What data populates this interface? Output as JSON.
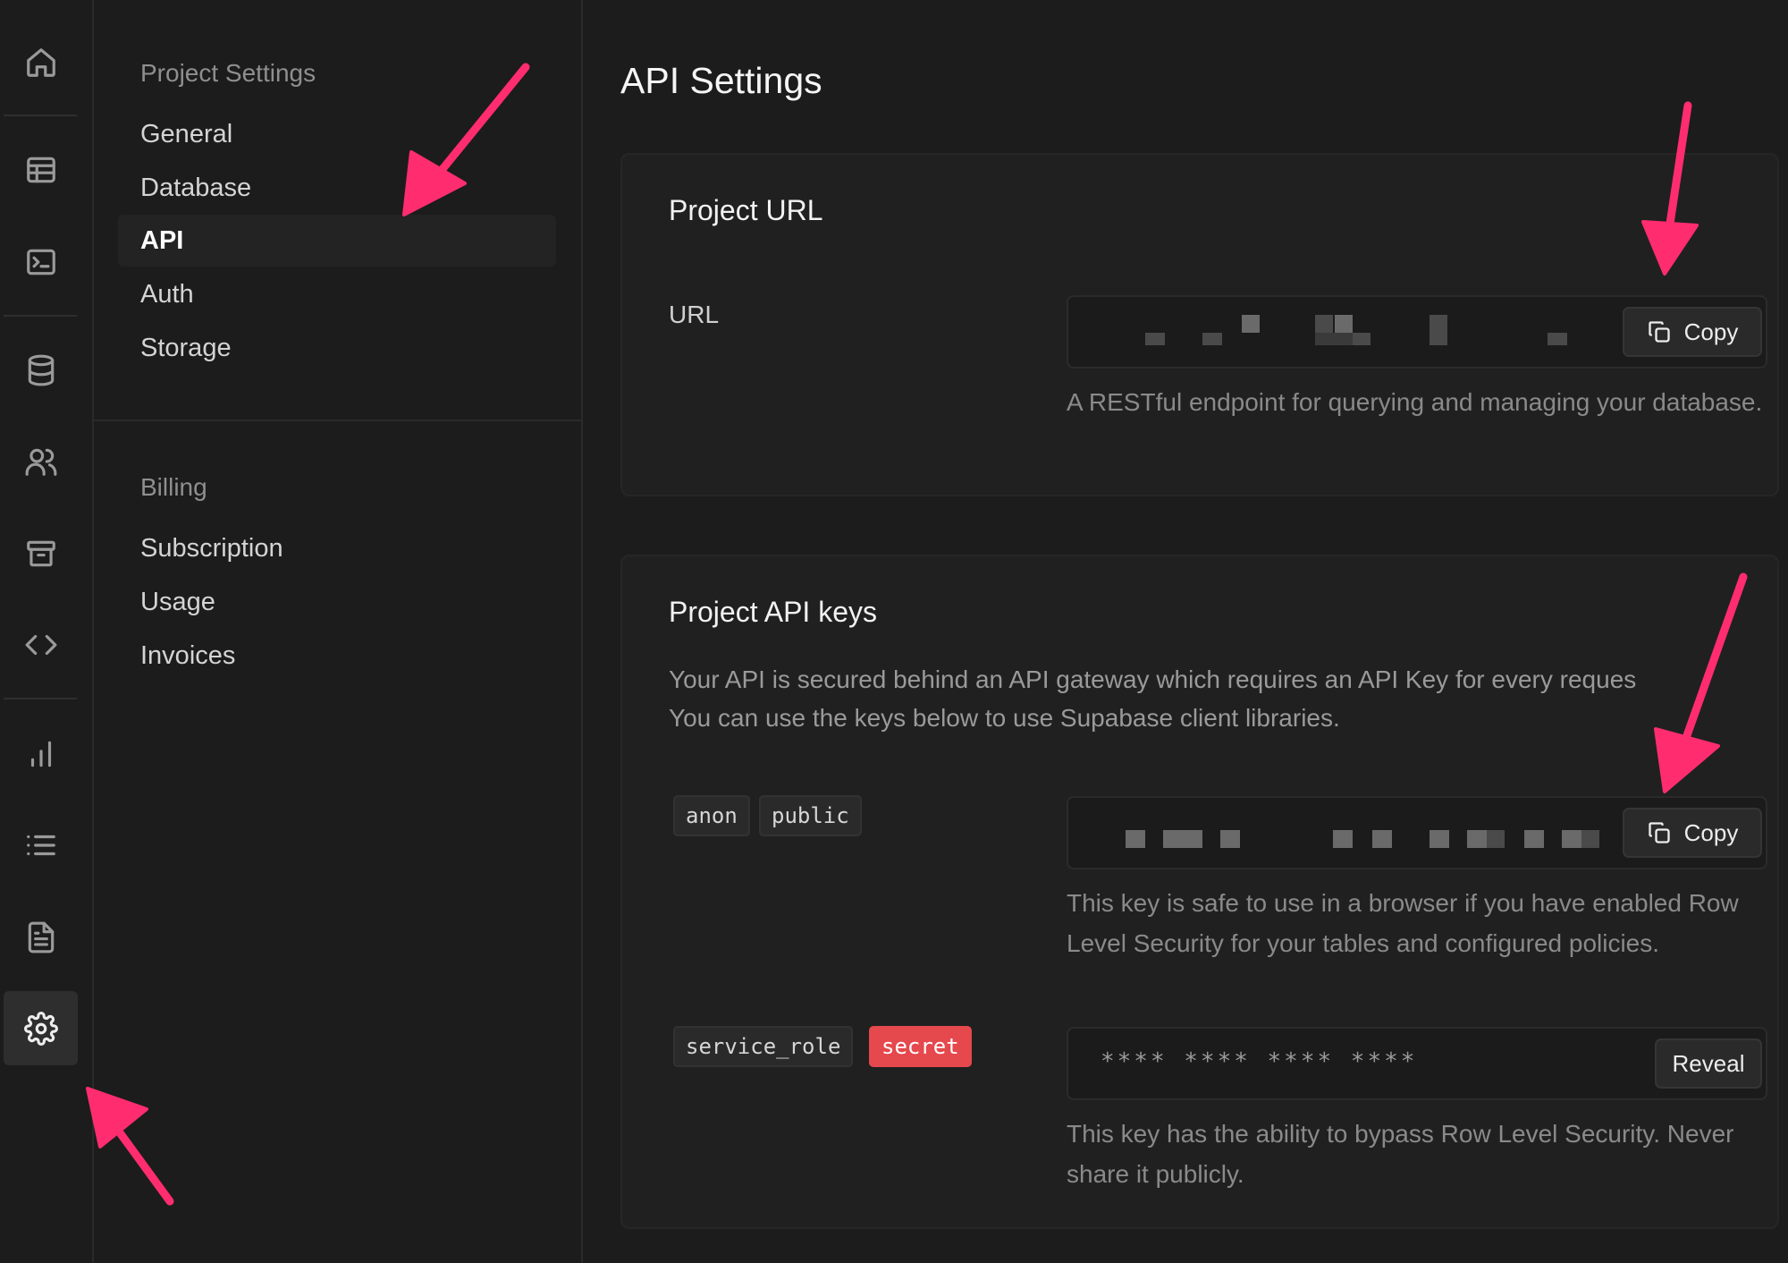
{
  "sidebar": {
    "icons": [
      "home-icon",
      "table-icon",
      "terminal-icon",
      "database-icon",
      "users-icon",
      "archive-icon",
      "code-icon",
      "chart-icon",
      "list-icon",
      "document-icon",
      "gear-icon"
    ],
    "active": "gear-icon"
  },
  "menu": {
    "project_heading": "Project Settings",
    "project_items": [
      "General",
      "Database",
      "API",
      "Auth",
      "Storage"
    ],
    "active_item": "API",
    "billing_heading": "Billing",
    "billing_items": [
      "Subscription",
      "Usage",
      "Invoices"
    ]
  },
  "page": {
    "title": "API Settings"
  },
  "project_url": {
    "title": "Project URL",
    "field_label": "URL",
    "copy_label": "Copy",
    "help": "A RESTful endpoint for querying and managing your database."
  },
  "api_keys": {
    "title": "Project API keys",
    "description_line1": "Your API is secured behind an API gateway which requires an API Key for every reques",
    "description_line2": "You can use the keys below to use Supabase client libraries.",
    "anon": {
      "tag1": "anon",
      "tag2": "public",
      "copy_label": "Copy",
      "help": "This key is safe to use in a browser if you have enabled Row Level Security for your tables and configured policies."
    },
    "service": {
      "tag1": "service_role",
      "tag2": "secret",
      "masked_value": "**** **** **** ****",
      "reveal_label": "Reveal",
      "help": "This key has the ability to bypass Row Level Security. Never share it publicly."
    }
  },
  "colors": {
    "annotation_arrow": "#ff2d6f",
    "secret_badge": "#e5484d"
  }
}
